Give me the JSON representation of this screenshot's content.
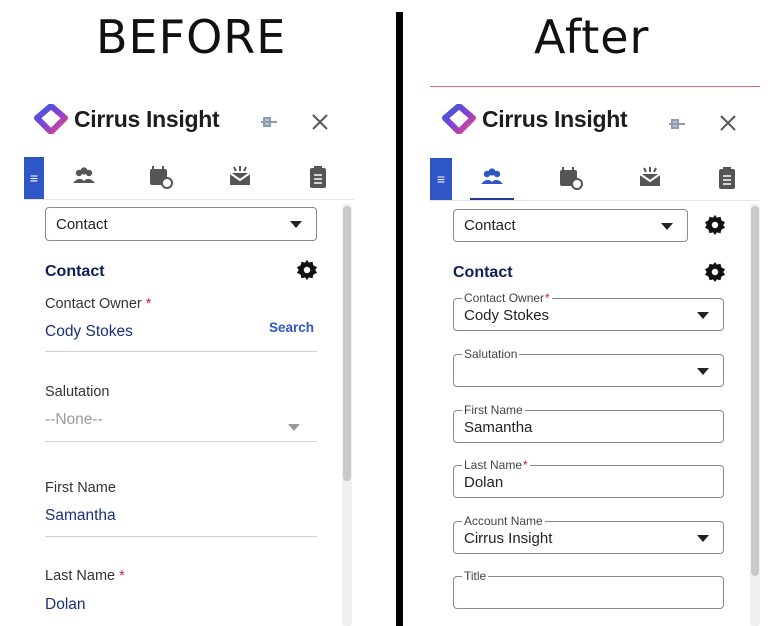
{
  "headings": {
    "before": "BEFORE",
    "after": "After"
  },
  "brand": {
    "name": "Cirrus Insight"
  },
  "icons": {
    "menu": "hamburger-menu-icon",
    "contacts": "contacts-icon",
    "calendar": "calendar-icon",
    "inbox": "inbox-icon",
    "clipboard": "clipboard-icon",
    "pin": "pin-icon",
    "close": "close-icon",
    "settings": "gear-icon"
  },
  "colors": {
    "accent": "#2f56c6",
    "section": "#0c1f59",
    "value": "#1a2f7a",
    "required": "#d11f2f"
  },
  "before": {
    "record_type": "Contact",
    "section_title": "Contact",
    "search_link": "Search",
    "fields": [
      {
        "label": "Contact Owner",
        "required": true,
        "value": "Cody Stokes"
      },
      {
        "label": "Salutation",
        "required": false,
        "value": "--None--"
      },
      {
        "label": "First Name",
        "required": false,
        "value": "Samantha"
      },
      {
        "label": "Last Name",
        "required": true,
        "value": "Dolan"
      }
    ]
  },
  "after": {
    "record_type": "Contact",
    "section_title": "Contact",
    "fields": [
      {
        "label": "Contact Owner",
        "required": true,
        "value": "Cody Stokes"
      },
      {
        "label": "Salutation",
        "required": false,
        "value": ""
      },
      {
        "label": "First Name",
        "required": false,
        "value": "Samantha"
      },
      {
        "label": "Last Name",
        "required": true,
        "value": "Dolan"
      },
      {
        "label": "Account Name",
        "required": false,
        "value": "Cirrus Insight"
      },
      {
        "label": "Title",
        "required": false,
        "value": ""
      }
    ]
  },
  "required_marker": "*"
}
